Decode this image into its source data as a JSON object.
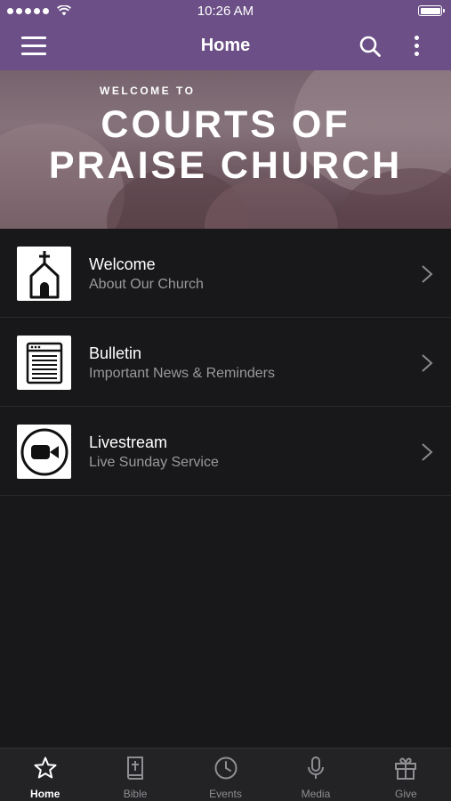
{
  "status_bar": {
    "time": "10:26 AM"
  },
  "nav": {
    "title": "Home",
    "icons": [
      "hamburger-menu-icon",
      "search-icon",
      "more-vertical-icon"
    ]
  },
  "banner": {
    "kicker": "WELCOME TO",
    "title_line1": "COURTS OF",
    "title_line2": "PRAISE CHURCH"
  },
  "list": {
    "items": [
      {
        "title": "Welcome",
        "subtitle": "About Our Church",
        "icon": "church-icon"
      },
      {
        "title": "Bulletin",
        "subtitle": "Important News & Reminders",
        "icon": "bulletin-icon"
      },
      {
        "title": "Livestream",
        "subtitle": "Live Sunday Service",
        "icon": "video-camera-icon"
      }
    ]
  },
  "tabs": [
    {
      "label": "Home",
      "icon": "star-icon",
      "active": true
    },
    {
      "label": "Bible",
      "icon": "bible-icon",
      "active": false
    },
    {
      "label": "Events",
      "icon": "clock-icon",
      "active": false
    },
    {
      "label": "Media",
      "icon": "microphone-icon",
      "active": false
    },
    {
      "label": "Give",
      "icon": "gift-icon",
      "active": false
    }
  ],
  "colors": {
    "header": "#6b4f86",
    "background": "#18181a",
    "tab_bar": "#232325",
    "subtitle": "#9a9a9e"
  }
}
